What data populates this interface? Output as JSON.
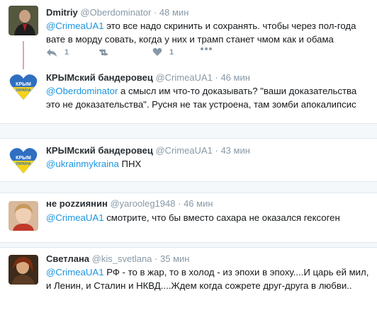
{
  "tweets": [
    {
      "name": "Dmitriy",
      "handle": "@Oberdominator",
      "time": "48 мин",
      "mention": "@CrimeaUA1",
      "text": " это все надо скринить и сохранять. чтобы через пол-года вате в морду совать, когда у них и трамп станет чмом как и обама",
      "reply_count": "1",
      "like_count": "1"
    },
    {
      "name": "КРЫМский бандеровец",
      "handle": "@CrimeaUA1",
      "time": "46 мин",
      "mention": "@Oberdominator",
      "text": " а смысл им что-то доказывать? \"ваши доказательства это не доказательства\". Русня не так устроена, там зомби апокалипсис",
      "avatar_top": "КРЫМ",
      "avatar_bottom": "УКРАЇНА"
    },
    {
      "name": "КРЫМский бандеровец",
      "handle": "@CrimeaUA1",
      "time": "43 мин",
      "mention": "@ukrainmykraina",
      "text": " ПНХ",
      "avatar_top": "КРЫМ",
      "avatar_bottom": "УКРАЇНА"
    },
    {
      "name": "не роzzиянин",
      "handle": "@yarooleg1948",
      "time": "46 мин",
      "mention": "@CrimeaUA1",
      "text": " смотрите, что бы вместо сахара не оказался гексоген"
    },
    {
      "name": "Светлана",
      "handle": "@kis_svetlana",
      "time": "35 мин",
      "mention": "@CrimeaUA1",
      "text": " РФ - то в жар, то в холод - из эпохи в эпоху....И царь ей мил, и Ленин, и Сталин и НКВД....Ждем когда сожрете друг-друга в любви.."
    }
  ],
  "separator": "·",
  "colors": {
    "link": "#1b95e0",
    "thread": "#e29fbe",
    "muted": "#8899a6"
  },
  "icons": [
    "reply-icon",
    "retweet-icon",
    "like-icon",
    "more-icon"
  ]
}
